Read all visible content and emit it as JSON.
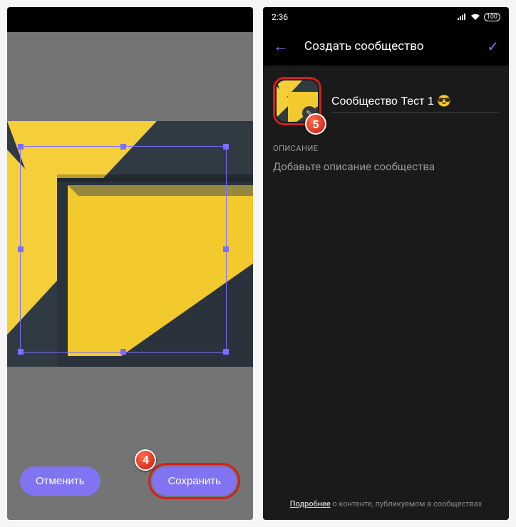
{
  "left": {
    "cancel_label": "Отменить",
    "save_label": "Сохранить",
    "step_badge": "4"
  },
  "right": {
    "status": {
      "time": "2:36",
      "battery": "100"
    },
    "appbar": {
      "title": "Создать сообщество"
    },
    "community_name": "Сообщество Тест 1 😎",
    "section_desc_label": "ОПИСАНИЕ",
    "desc_placeholder": "Добавьте описание сообщества",
    "footer_bold": "Подробнее",
    "footer_rest": " о контенте, публикуемом в сообществах",
    "step_badge": "5"
  }
}
